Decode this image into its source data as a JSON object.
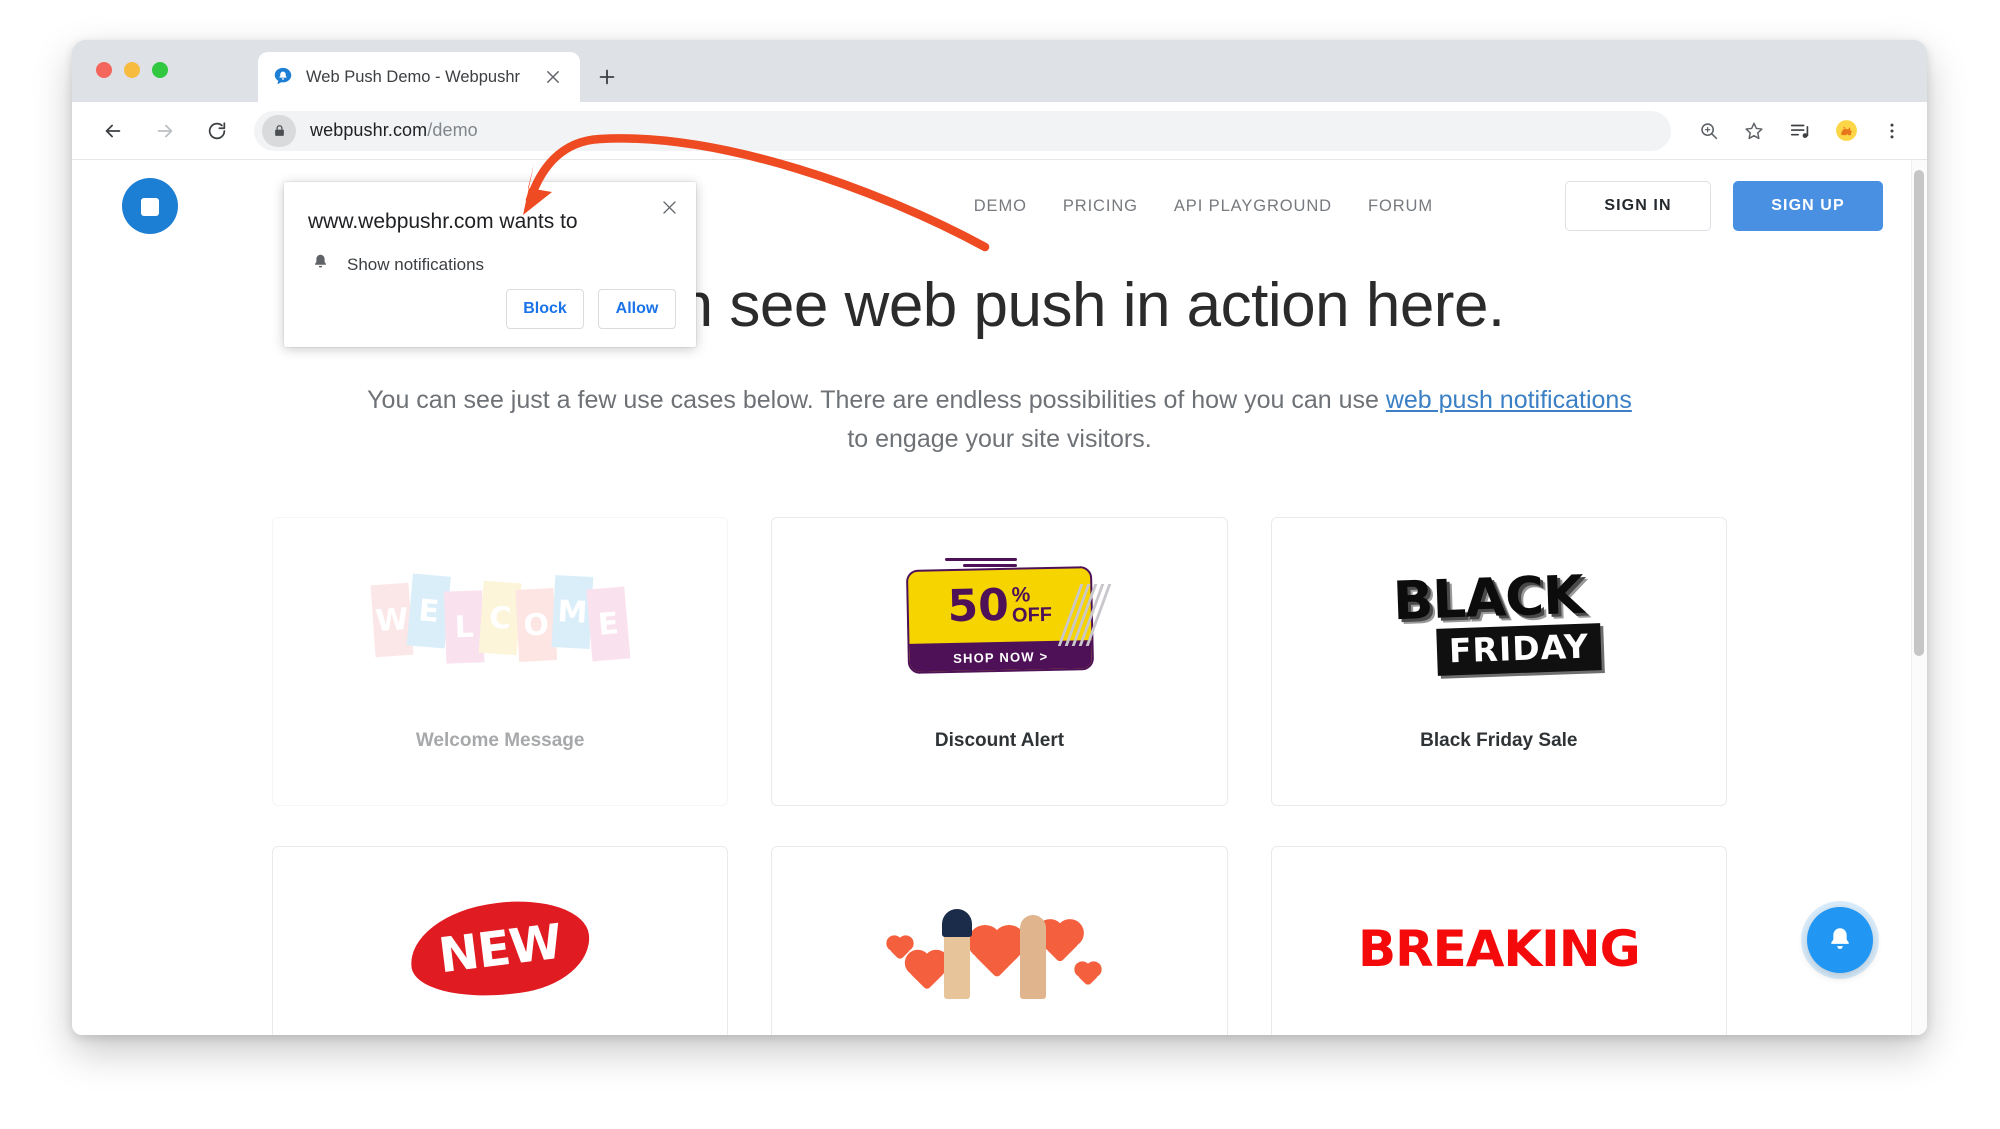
{
  "browser": {
    "tab": {
      "title": "Web Push Demo - Webpushr",
      "favicon": "webpushr-bell-favicon",
      "close_label": "×",
      "new_tab_label": "+"
    },
    "toolbar": {
      "back_icon": "back-arrow-icon",
      "forward_icon": "forward-arrow-icon",
      "reload_icon": "reload-icon",
      "lock_icon": "lock-icon",
      "url_domain": "webpushr.com",
      "url_path": "/demo",
      "url_full": "webpushr.com/demo",
      "actions": [
        {
          "name": "zoom-in-icon",
          "title": "Zoom"
        },
        {
          "name": "bookmark-star-icon",
          "title": "Bookmark this tab"
        },
        {
          "name": "media-playlist-icon",
          "title": "Media"
        },
        {
          "name": "extension-dog-icon",
          "title": "Extension"
        },
        {
          "name": "more-menu-icon",
          "title": "Customize and control Google Chrome"
        }
      ]
    },
    "window_controls": [
      "close",
      "minimize",
      "maximize"
    ]
  },
  "permission_dialog": {
    "title": "www.webpushr.com wants to",
    "item_icon": "bell-icon",
    "item_label": "Show notifications",
    "block_label": "Block",
    "allow_label": "Allow",
    "close_label": "×"
  },
  "site": {
    "logo": "webpushr-circle-logo",
    "nav": [
      {
        "label": "DEMO"
      },
      {
        "label": "PRICING"
      },
      {
        "label": "API PLAYGROUND"
      },
      {
        "label": "FORUM"
      }
    ],
    "sign_in_label": "SIGN IN",
    "sign_up_label": "SIGN UP",
    "hero": {
      "title": "You can see web push in action here.",
      "sub_before": "You can see just a few use cases below. There are endless possibilities of how you can use ",
      "sub_link": "web push notifications",
      "sub_after": " to engage your site visitors."
    },
    "cards": [
      {
        "label": "Welcome Message",
        "art": "welcome-art",
        "art_text": "WELCOME",
        "faded": true
      },
      {
        "label": "Discount Alert",
        "art": "discount-art",
        "art_text_main": "50",
        "art_text_pct": "%",
        "art_text_off": "OFF",
        "art_text_cta": "SHOP NOW >",
        "faded": false
      },
      {
        "label": "Black Friday Sale",
        "art": "black-friday-art",
        "art_text_top": "BLACK",
        "art_text_bottom": "FRIDAY",
        "faded": false
      },
      {
        "label": "",
        "art": "new-art",
        "art_text": "NEW",
        "faded": false
      },
      {
        "label": "",
        "art": "love-art",
        "art_text": "",
        "faded": false
      },
      {
        "label": "",
        "art": "breaking-art",
        "art_text": "BREAKING",
        "faded": false
      }
    ],
    "fab": {
      "icon": "bell-icon",
      "label": ""
    }
  },
  "annotation": {
    "type": "curved-arrow",
    "color": "#ee4b22",
    "points_at": "permission_dialog"
  },
  "colors": {
    "accent_blue": "#4a90e2",
    "link_blue": "#1a73e8",
    "fab_blue": "#2196f3",
    "annotation_red": "#ee4b22",
    "discount_yellow": "#f6d400",
    "discount_purple": "#4e1157",
    "breaking_red": "#f40a0a",
    "new_red": "#e01b21"
  }
}
